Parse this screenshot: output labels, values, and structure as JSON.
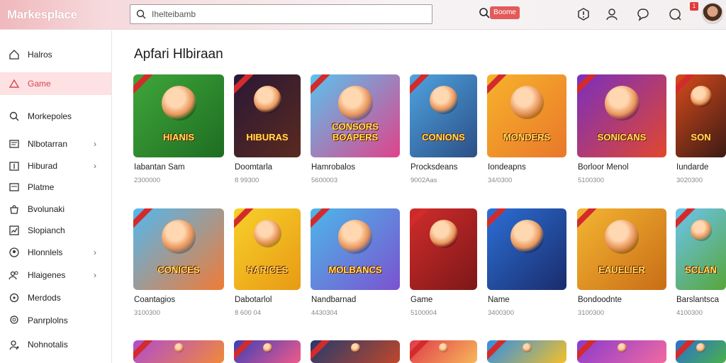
{
  "header": {
    "brand": "Markesplace",
    "search_placeholder": "Ihelteibamb",
    "badge": "Boome",
    "notif_count": "1"
  },
  "sidebar": {
    "items": [
      {
        "label": "Halros",
        "icon": "home-icon",
        "chevron": false,
        "active": false
      },
      {
        "label": "Game",
        "icon": "triangle-icon",
        "chevron": false,
        "active": true
      },
      {
        "label": "Morkepoles",
        "icon": "search-icon",
        "chevron": false,
        "active": false
      },
      {
        "label": "Nlbotarran",
        "icon": "card-icon",
        "chevron": true,
        "active": false
      },
      {
        "label": "Hiburad",
        "icon": "calendar-icon",
        "chevron": true,
        "active": false
      },
      {
        "label": "Platme",
        "icon": "box-icon",
        "chevron": false,
        "active": false
      },
      {
        "label": "Bvolunaki",
        "icon": "bag-icon",
        "chevron": false,
        "active": false
      },
      {
        "label": "Slopianch",
        "icon": "chart-icon",
        "chevron": false,
        "active": false
      },
      {
        "label": "Hlonnlels",
        "icon": "group-icon",
        "chevron": true,
        "active": false
      },
      {
        "label": "Hlaigenes",
        "icon": "people-icon",
        "chevron": true,
        "active": false
      },
      {
        "label": "Merdods",
        "icon": "settings-icon",
        "chevron": false,
        "active": false
      },
      {
        "label": "Panrplolns",
        "icon": "location-icon",
        "chevron": false,
        "active": false
      },
      {
        "label": "Nohnotalis",
        "icon": "person-icon",
        "chevron": false,
        "active": false
      }
    ]
  },
  "main": {
    "title": "Apfari Hlbiraan",
    "rows": [
      [
        {
          "name": "Iabantan Sam",
          "price": "2300000",
          "art": "HIANIS",
          "c1": "#3fa63a",
          "c2": "#1e6d22"
        },
        {
          "name": "Doomtarla",
          "price": "8 99300",
          "art": "HIBURAS",
          "c1": "#2a1836",
          "c2": "#5a2a1f"
        },
        {
          "name": "Hamrobalos",
          "price": "5600003",
          "art": "CONSORS BOAPERS",
          "c1": "#59c3ee",
          "c2": "#e0428a"
        },
        {
          "name": "Procksdeans",
          "price": "9002Aas",
          "art": "CONIONS",
          "c1": "#4fa3e0",
          "c2": "#2b4f86"
        },
        {
          "name": "Iondeapns",
          "price": "34/0300",
          "art": "MONDERS",
          "c1": "#f7b32b",
          "c2": "#e9772a"
        },
        {
          "name": "Borloor Menol",
          "price": "5100300",
          "art": "SONICANS",
          "c1": "#7a2fbf",
          "c2": "#e2472d"
        },
        {
          "name": "Iundarde",
          "price": "3020300",
          "art": "SON",
          "c1": "#d84a1c",
          "c2": "#3b1b14"
        }
      ],
      [
        {
          "name": "Coantagios",
          "price": "3100300",
          "art": "CONICES",
          "c1": "#52b8f0",
          "c2": "#f07b36"
        },
        {
          "name": "Dabotarlol",
          "price": "8 600 04",
          "art": "HARICES",
          "c1": "#f7d02a",
          "c2": "#e89a14"
        },
        {
          "name": "Nandbarnad",
          "price": "4430304",
          "art": "MOLBANCS",
          "c1": "#4cb7e8",
          "c2": "#7b52d0"
        },
        {
          "name": "Game",
          "price": "5100004",
          "art": "",
          "c1": "#d02c2c",
          "c2": "#7d1717"
        },
        {
          "name": "Name",
          "price": "3400300",
          "art": "",
          "c1": "#2c6fd6",
          "c2": "#1a2c6b"
        },
        {
          "name": "Bondoodnte",
          "price": "3100300",
          "art": "EAUELIER",
          "c1": "#f4b531",
          "c2": "#c86d16"
        },
        {
          "name": "Barslantsca",
          "price": "4100300",
          "art": "SCLAN",
          "c1": "#6dc4ef",
          "c2": "#56a63a"
        }
      ],
      [
        {
          "name": "",
          "price": "",
          "art": "",
          "c1": "#b04bd0",
          "c2": "#f08a3a"
        },
        {
          "name": "",
          "price": "",
          "art": "",
          "c1": "#3b3fb8",
          "c2": "#f05a8a"
        },
        {
          "name": "",
          "price": "",
          "art": "",
          "c1": "#233a6e",
          "c2": "#c0472a"
        },
        {
          "name": "",
          "price": "",
          "art": "",
          "c1": "#e03a4a",
          "c2": "#f7b85a"
        },
        {
          "name": "",
          "price": "",
          "art": "",
          "c1": "#2d8ee8",
          "c2": "#f4c02a"
        },
        {
          "name": "",
          "price": "",
          "art": "",
          "c1": "#8a3ad0",
          "c2": "#f06aa0"
        },
        {
          "name": "",
          "price": "",
          "art": "",
          "c1": "#2a6fd0",
          "c2": "#4ab04a"
        }
      ]
    ]
  }
}
